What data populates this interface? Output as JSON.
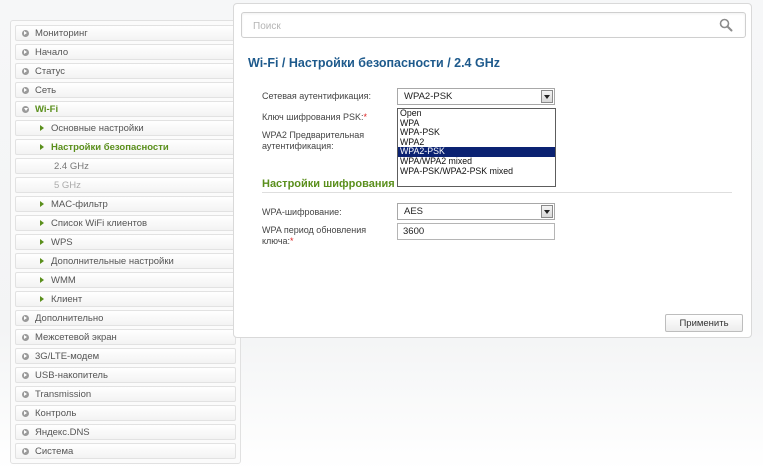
{
  "search": {
    "placeholder": "Поиск",
    "value": ""
  },
  "sidebar": {
    "items": [
      {
        "label": "Мониторинг"
      },
      {
        "label": "Начало"
      },
      {
        "label": "Статус"
      },
      {
        "label": "Сеть"
      },
      {
        "label": "Wi-Fi"
      },
      {
        "label": "Основные настройки"
      },
      {
        "label": "Настройки безопасности"
      },
      {
        "label": "2.4 GHz"
      },
      {
        "label": "5 GHz"
      },
      {
        "label": "MAC-фильтр"
      },
      {
        "label": "Список WiFi клиентов"
      },
      {
        "label": "WPS"
      },
      {
        "label": "Дополнительные настройки"
      },
      {
        "label": "WMM"
      },
      {
        "label": "Клиент"
      },
      {
        "label": "Дополнительно"
      },
      {
        "label": "Межсетевой экран"
      },
      {
        "label": "3G/LTE-модем"
      },
      {
        "label": "USB-накопитель"
      },
      {
        "label": "Transmission"
      },
      {
        "label": "Контроль"
      },
      {
        "label": "Яндекс.DNS"
      },
      {
        "label": "Система"
      }
    ]
  },
  "main": {
    "title": "Wi-Fi /  Настройки безопасности /  2.4 GHz",
    "network_auth": {
      "label": "Сетевая аутентификация:",
      "value": "WPA2-PSK"
    },
    "psk_key": {
      "label": "Ключ шифрования PSK:",
      "required": "*"
    },
    "wpa2_preauth": {
      "label_line1": "WPA2 Предварительная",
      "label_line2": "аутентификация:"
    },
    "auth_options": [
      "Open",
      "WPA",
      "WPA-PSK",
      "WPA2",
      "WPA2-PSK",
      "WPA/WPA2 mixed",
      "WPA-PSK/WPA2-PSK mixed"
    ],
    "selected_option_index": 4,
    "encryption_section_title": "Настройки шифрования W",
    "wpa_cipher": {
      "label": "WPA-шифрование:",
      "value": "AES"
    },
    "wpa_rekey": {
      "label_line1": "WPA период обновления",
      "label_line2": "ключа:",
      "required": "*",
      "value": "3600"
    },
    "apply_label": "Применить"
  },
  "colors": {
    "title_blue": "#1e5a8c",
    "accent_green": "#5a8f1c",
    "selected_option_bg": "#0b2272",
    "required_red": "#d22222"
  }
}
